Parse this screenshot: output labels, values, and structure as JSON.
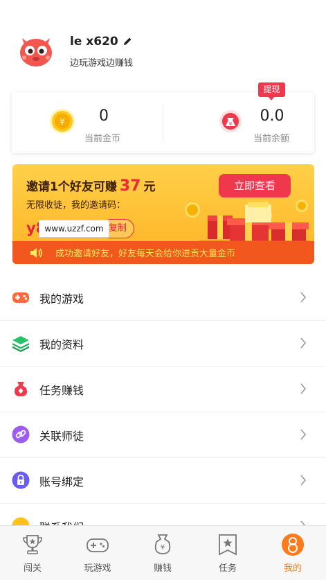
{
  "profile": {
    "username": "le x620",
    "tagline": "边玩游戏边赚钱",
    "edit_icon": "pencil-icon",
    "avatar_icon": "cat-avatar-icon"
  },
  "balance": {
    "coins_value": "0",
    "coins_label": "当前金币",
    "cash_value": "0.0",
    "cash_label": "当前余额",
    "withdraw_label": "提现"
  },
  "banner": {
    "title_prefix": "邀请1个好友可赚",
    "amount": "37",
    "title_suffix": "元",
    "subtitle": "无限收徒，我的邀请码：",
    "code_partial": "y8",
    "watermark": "www.uzzf.com",
    "copy_label": "复制",
    "view_button": "立即查看",
    "scroll_text": "成功邀请好友，好友每天会给你进贡大量金币"
  },
  "menu": {
    "items": [
      {
        "label": "我的游戏",
        "icon": "gamepad-icon"
      },
      {
        "label": "我的资料",
        "icon": "layers-icon"
      },
      {
        "label": "任务赚钱",
        "icon": "money-bag-icon"
      },
      {
        "label": "关联师徒",
        "icon": "link-icon"
      },
      {
        "label": "账号绑定",
        "icon": "lock-icon"
      },
      {
        "label": "联系我们",
        "icon": "contact-icon"
      }
    ]
  },
  "nav": {
    "items": [
      {
        "label": "闯关",
        "icon": "trophy-icon"
      },
      {
        "label": "玩游戏",
        "icon": "gamepad-icon"
      },
      {
        "label": "赚钱",
        "icon": "money-bag-icon"
      },
      {
        "label": "任务",
        "icon": "star-badge-icon"
      },
      {
        "label": "我的",
        "icon": "user-icon"
      }
    ],
    "active_index": 4
  },
  "colors": {
    "accent_red": "#f0384d",
    "nav_active": "#ff7a1a",
    "banner_yellow": "#ffc233",
    "banner_orange": "#f2581e"
  }
}
